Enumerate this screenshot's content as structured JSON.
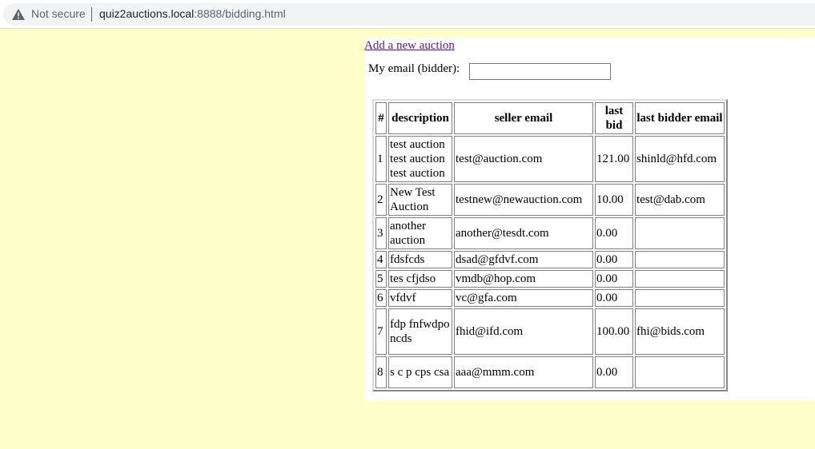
{
  "browser": {
    "security_label": "Not secure",
    "url_host": "quiz2auctions.local",
    "url_rest": ":8888/bidding.html"
  },
  "page": {
    "add_link": "Add a new auction",
    "email_label": "My email (bidder):",
    "email_value": ""
  },
  "table": {
    "headers": [
      "#",
      "description",
      "seller email",
      "last bid",
      "last bidder email"
    ],
    "rows": [
      {
        "num": "1",
        "description": "test auction test auction test auction",
        "seller": "test@auction.com",
        "bid": "121.00",
        "bidder": "shinld@hfd.com"
      },
      {
        "num": "2",
        "description": "New Test Auction",
        "seller": "testnew@newauction.com",
        "bid": "10.00",
        "bidder": "test@dab.com"
      },
      {
        "num": "3",
        "description": "another auction",
        "seller": "another@tesdt.com",
        "bid": "0.00",
        "bidder": ""
      },
      {
        "num": "4",
        "description": "fdsfcds",
        "seller": "dsad@gfdvf.com",
        "bid": "0.00",
        "bidder": ""
      },
      {
        "num": "5",
        "description": "tes cfjdso",
        "seller": "vmdb@hop.com",
        "bid": "0.00",
        "bidder": ""
      },
      {
        "num": "6",
        "description": "vfdvf",
        "seller": "vc@gfa.com",
        "bid": "0.00",
        "bidder": ""
      },
      {
        "num": "7",
        "description": "fdp fnfwdpo ncds",
        "seller": "fhid@ifd.com",
        "bid": "100.00",
        "bidder": "fhi@bids.com"
      },
      {
        "num": "8",
        "description": "s c p cps csa",
        "seller": "aaa@mmm.com",
        "bid": "0.00",
        "bidder": ""
      }
    ]
  }
}
